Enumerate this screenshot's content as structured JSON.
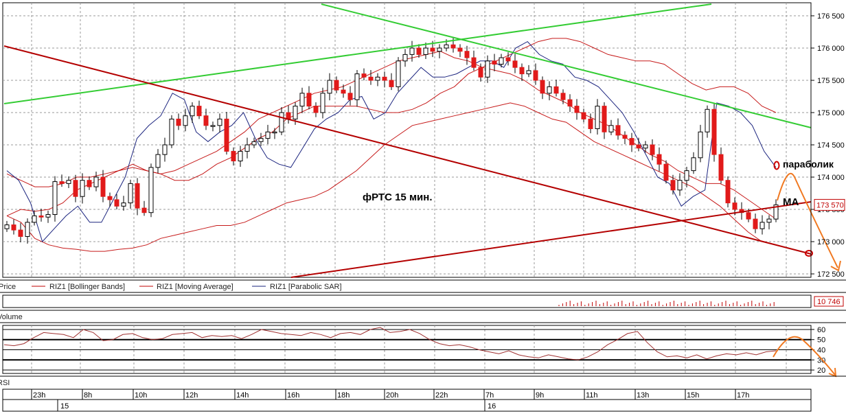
{
  "chart_data": {
    "type": "candlestick",
    "title": "фРТС   15 мин.",
    "price_axis": {
      "ticks": [
        "176 500",
        "176 000",
        "175 500",
        "175 000",
        "174 500",
        "174 000",
        "173 500",
        "173 000",
        "172 500"
      ],
      "tick_values": [
        176500,
        176000,
        175500,
        175000,
        174500,
        174000,
        173500,
        173000,
        172500
      ],
      "ylim": [
        172500,
        176500
      ],
      "last_price_label": "173 570",
      "last_price": 173570
    },
    "legend": [
      "Price",
      "RIZ1 [Bollinger Bands]",
      "RIZ1 [Moving Average]",
      "RIZ1 [Parabolic SAR]"
    ],
    "volume": {
      "label": "Volume",
      "last_label": "10 746"
    },
    "rsi": {
      "label": "RSI",
      "ticks": [
        "60",
        "50",
        "40",
        "30",
        "20"
      ],
      "tick_values": [
        60,
        50,
        40,
        30,
        20
      ],
      "ylim": [
        18,
        62
      ]
    },
    "time_axis": {
      "hour_labels": [
        "23h",
        "8h",
        "10h",
        "12h",
        "14h",
        "16h",
        "18h",
        "20h",
        "22h",
        "7h",
        "9h",
        "11h",
        "13h",
        "15h",
        "17h"
      ],
      "day_labels": [
        "15",
        "16"
      ]
    },
    "annotations": {
      "parabolic_label": "параболик",
      "ma_label": "MA"
    },
    "close_series": [
      173260,
      173180,
      173080,
      173300,
      173400,
      173380,
      173420,
      173930,
      173900,
      173950,
      173700,
      173950,
      173850,
      174000,
      173700,
      173650,
      173550,
      173600,
      173900,
      173520,
      173450,
      174150,
      174350,
      174500,
      174900,
      174800,
      174950,
      175100,
      174950,
      174800,
      174800,
      174900,
      174400,
      174250,
      174400,
      174500,
      174550,
      174600,
      174700,
      174700,
      175000,
      174900,
      175100,
      175300,
      175100,
      175000,
      175300,
      175500,
      175350,
      175300,
      175200,
      175600,
      175550,
      175500,
      175550,
      175500,
      175400,
      175800,
      175900,
      176000,
      175900,
      176000,
      175950,
      176000,
      176050,
      176000,
      175950,
      175850,
      175700,
      175550,
      175800,
      175750,
      175850,
      175800,
      175700,
      175600,
      175650,
      175500,
      175300,
      175400,
      175300,
      175200,
      175100,
      175000,
      174900,
      174750,
      175100,
      174700,
      174800,
      174650,
      174600,
      174500,
      174450,
      174500,
      174350,
      174200,
      173950,
      173800,
      173950,
      174100,
      174300,
      174700,
      175050,
      174350,
      173950,
      173600,
      173500,
      173450,
      173350,
      173200,
      173300,
      173350,
      173570
    ],
    "bb_upper": [
      174050,
      173950,
      173850,
      173850,
      173900,
      174000,
      174000,
      174050,
      174100,
      174200,
      174100,
      174050,
      173950,
      173950,
      174050,
      174200,
      174300,
      174450,
      174600,
      174700,
      174900,
      175000,
      175100,
      175100,
      175100,
      175100,
      175050,
      175000,
      175000,
      175050,
      175150,
      175300,
      175400,
      175600,
      175700,
      175800,
      175900,
      176000,
      176100,
      176150,
      176150,
      176100,
      176000,
      175900,
      175850,
      175800,
      175800,
      175750,
      175600,
      175450,
      175350,
      175400,
      175400,
      175300,
      175100,
      175000
    ],
    "bb_lower": [
      173400,
      173300,
      173050,
      172950,
      172900,
      172880,
      172850,
      172850,
      172880,
      172900,
      172950,
      173050,
      173100,
      173150,
      173200,
      173250,
      173250,
      173300,
      173400,
      173500,
      173600,
      173650,
      173700,
      173800,
      173950,
      174100,
      174300,
      174500,
      174650,
      174800,
      174850,
      174900,
      174950,
      175000,
      175050,
      175100,
      175150,
      175100,
      175000,
      174900,
      174850,
      174700,
      174550,
      174450,
      174350,
      174250,
      174150,
      174050,
      173950,
      173850,
      173700,
      173550,
      173350,
      173150,
      173000,
      172950
    ],
    "ma": [
      173400,
      173500,
      173470,
      173500,
      173600,
      173800,
      173900,
      174000,
      174100,
      174150,
      174100,
      174050,
      174100,
      174200,
      174300,
      174400,
      174550,
      174700,
      174900,
      175000,
      175100,
      175200,
      175300,
      175350,
      175400,
      175500,
      175600,
      175700,
      175800,
      175850,
      175900,
      175950,
      175850,
      175800,
      175700,
      175650,
      175600,
      175500,
      175350,
      175250,
      175150,
      175000,
      174900,
      174800,
      174650,
      174500,
      174350,
      174250,
      174100,
      174000,
      173900,
      173900,
      173800,
      173650,
      173500,
      173350
    ],
    "sar": [
      174100,
      173950,
      173600,
      173000,
      173200,
      173400,
      173550,
      173300,
      173300,
      173650,
      174000,
      174600,
      174800,
      174950,
      175300,
      175200,
      174700,
      174550,
      174700,
      174800,
      175000,
      174600,
      174300,
      174200,
      174150,
      174450,
      174750,
      174900,
      175000,
      175200,
      175250,
      174900,
      175000,
      175300,
      175500,
      175700,
      175550,
      175550,
      175600,
      175700,
      175800,
      175800,
      175700,
      176000,
      176100,
      175900,
      175800,
      175750,
      175550,
      175500,
      175400,
      175200,
      175000,
      174700,
      174350,
      174000,
      173900,
      173550,
      173700,
      173800,
      175150,
      175100,
      175000,
      174800,
      174400,
      174150
    ],
    "rsi_values": [
      45,
      44,
      46,
      52,
      57,
      56,
      55,
      52,
      60,
      57,
      49,
      50,
      55,
      56,
      52,
      50,
      51,
      55,
      56,
      57,
      52,
      54,
      53,
      54,
      51,
      55,
      60,
      58,
      56,
      55,
      54,
      57,
      55,
      52,
      56,
      57,
      55,
      60,
      62,
      57,
      58,
      60,
      56,
      50,
      46,
      44,
      45,
      43,
      40,
      38,
      36,
      39,
      35,
      33,
      32,
      35,
      33,
      31,
      30,
      33,
      38,
      45,
      50,
      56,
      58,
      47,
      38,
      33,
      34,
      32,
      35,
      31,
      34,
      36,
      35,
      37,
      35,
      38,
      39
    ],
    "lines": {
      "green_upper": [
        [
          0,
          175100
        ],
        [
          1,
          176650
        ]
      ],
      "green_lower": [
        [
          0,
          176200
        ],
        [
          1,
          174750
        ]
      ],
      "red_downtrend": [
        [
          0,
          176000
        ],
        [
          1,
          172800
        ]
      ],
      "red_uptrend": [
        [
          0,
          172500
        ],
        [
          1,
          173550
        ]
      ]
    },
    "forecast": {
      "price_arc_peak": 174000,
      "price_arc_end": 172500,
      "rsi_arc_peak": 54,
      "rsi_arc_end": 20
    },
    "colors": {
      "bull": "#ffffff",
      "bear": "#e11a1a",
      "bb": "#c00000",
      "ma": "#c00000",
      "sar": "#1a237e",
      "green": "#33cc33",
      "trend_red": "#b40000",
      "forecast": "#f07820",
      "rsi_line": "#a03030"
    }
  }
}
